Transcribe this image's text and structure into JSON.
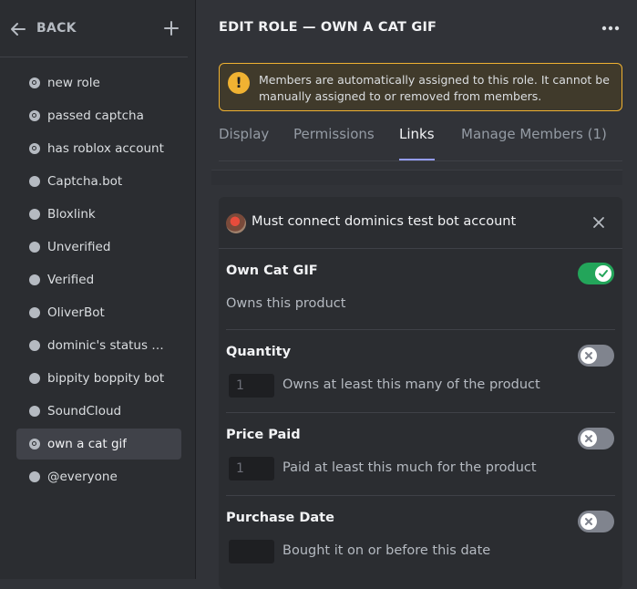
{
  "sidebar": {
    "back_label": "BACK",
    "roles": [
      {
        "label": "new role",
        "icon": "link"
      },
      {
        "label": "passed captcha",
        "icon": "link"
      },
      {
        "label": "has roblox account",
        "icon": "link"
      },
      {
        "label": "Captcha.bot",
        "icon": "dot"
      },
      {
        "label": "Bloxlink",
        "icon": "dot"
      },
      {
        "label": "Unverified",
        "icon": "dot"
      },
      {
        "label": "Verified",
        "icon": "dot"
      },
      {
        "label": "OliverBot",
        "icon": "dot"
      },
      {
        "label": "dominic's status > do...",
        "icon": "dot"
      },
      {
        "label": "bippity boppity bot",
        "icon": "dot"
      },
      {
        "label": "SoundCloud",
        "icon": "dot"
      },
      {
        "label": "own a cat gif",
        "icon": "link",
        "selected": true
      },
      {
        "label": "@everyone",
        "icon": "dot"
      }
    ]
  },
  "main": {
    "title": "EDIT ROLE — OWN A CAT GIF",
    "notice": "Members are automatically assigned to this role. It cannot be manually assigned to or removed from members.",
    "tabs": [
      "Display",
      "Permissions",
      "Links",
      "Manage Members (1)"
    ],
    "active_tab": "Links",
    "card": {
      "title": "Must connect dominics test bot account",
      "sections": {
        "own": {
          "title": "Own Cat GIF",
          "desc": "Owns this product",
          "enabled": true
        },
        "quantity": {
          "title": "Quantity",
          "placeholder": "1",
          "desc": "Owns at least this many of the product",
          "enabled": false
        },
        "price": {
          "title": "Price Paid",
          "placeholder": "1",
          "desc": "Paid at least this much for the product",
          "enabled": false
        },
        "date": {
          "title": "Purchase Date",
          "placeholder": "",
          "desc": "Bought it on or before this date",
          "enabled": false
        }
      }
    }
  },
  "colors": {
    "background": "#313338",
    "sidebar": "#2b2d31",
    "accent": "#949cf7",
    "toggle_on": "#23a55a",
    "toggle_off": "#80848e",
    "warning": "#f0b232"
  }
}
